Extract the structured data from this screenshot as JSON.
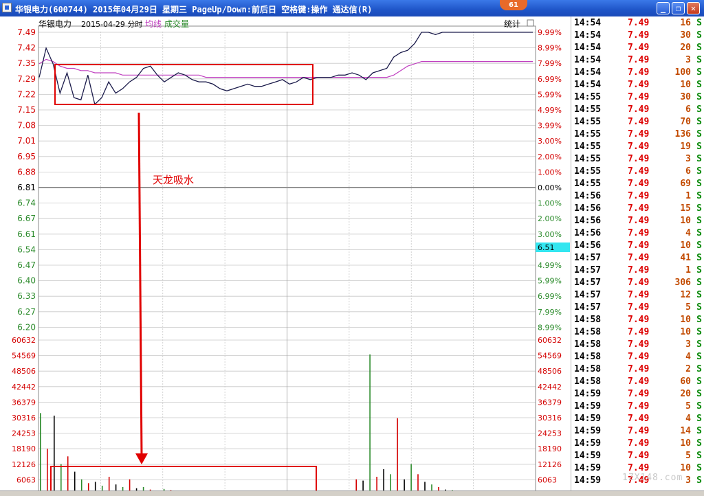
{
  "window": {
    "title": "华银电力(600744) 2015年04月29日 星期三 PageUp/Down:前后日 空格键:操作 通达信(R)",
    "badge": "61",
    "min_glyph": "_",
    "max_glyph": "❐",
    "close_glyph": "✕"
  },
  "chart_header": {
    "stock_name": "华银电力",
    "date_label": "2015-04-29 分时",
    "avg_label": "均线",
    "vol_label": "成交量",
    "stats_button": "统计"
  },
  "annotation": {
    "text": "天龙吸水",
    "color": "#e00000"
  },
  "colors": {
    "up": "#d40000",
    "down": "#2a8a2a",
    "price_line": "#1a1a4a",
    "avg_line": "#c040c0",
    "grid": "#c8c8c8",
    "flag_bg": "#33e6f0"
  },
  "chart_data": {
    "type": "line",
    "price_axis": {
      "ticks": [
        "7.49",
        "7.42",
        "7.35",
        "7.29",
        "7.22",
        "7.15",
        "7.08",
        "7.01",
        "6.95",
        "6.88",
        "6.81",
        "6.74",
        "6.67",
        "6.61",
        "6.54",
        "6.47",
        "6.40",
        "6.33",
        "6.27",
        "6.20"
      ],
      "pct": [
        "9.99%",
        "8.99%",
        "7.99%",
        "6.99%",
        "5.99%",
        "4.99%",
        "3.99%",
        "3.00%",
        "2.00%",
        "1.00%",
        "0.00%",
        "1.00%",
        "2.00%",
        "3.00%",
        "",
        "4.99%",
        "5.99%",
        "6.99%",
        "7.99%",
        "8.99%"
      ],
      "prev_close": 6.81,
      "current_flag": "6.51"
    },
    "volume_axis": {
      "ticks": [
        "60632",
        "54569",
        "48506",
        "42442",
        "36379",
        "30316",
        "24253",
        "18190",
        "12126",
        "6063"
      ]
    },
    "price_series": [
      7.29,
      7.42,
      7.35,
      7.22,
      7.31,
      7.2,
      7.19,
      7.3,
      7.17,
      7.2,
      7.27,
      7.22,
      7.24,
      7.27,
      7.29,
      7.33,
      7.34,
      7.3,
      7.27,
      7.29,
      7.31,
      7.3,
      7.28,
      7.27,
      7.27,
      7.26,
      7.24,
      7.23,
      7.24,
      7.25,
      7.26,
      7.25,
      7.25,
      7.26,
      7.27,
      7.28,
      7.26,
      7.27,
      7.29,
      7.28,
      7.29,
      7.29,
      7.29,
      7.3,
      7.3,
      7.31,
      7.3,
      7.28,
      7.31,
      7.32,
      7.33,
      7.38,
      7.4,
      7.41,
      7.44,
      7.49,
      7.49,
      7.48,
      7.49,
      7.49,
      7.49,
      7.49,
      7.49,
      7.49,
      7.49,
      7.49,
      7.49,
      7.49,
      7.49,
      7.49,
      7.49,
      7.49
    ],
    "avg_series": [
      7.35,
      7.37,
      7.36,
      7.34,
      7.33,
      7.33,
      7.32,
      7.32,
      7.31,
      7.31,
      7.31,
      7.31,
      7.3,
      7.3,
      7.3,
      7.3,
      7.3,
      7.3,
      7.3,
      7.3,
      7.3,
      7.3,
      7.3,
      7.3,
      7.29,
      7.29,
      7.29,
      7.29,
      7.29,
      7.29,
      7.29,
      7.29,
      7.29,
      7.29,
      7.29,
      7.29,
      7.29,
      7.29,
      7.29,
      7.29,
      7.29,
      7.29,
      7.29,
      7.29,
      7.29,
      7.29,
      7.29,
      7.29,
      7.29,
      7.29,
      7.29,
      7.3,
      7.32,
      7.34,
      7.35,
      7.36,
      7.36,
      7.36,
      7.36,
      7.36,
      7.36,
      7.36,
      7.36,
      7.36,
      7.36,
      7.36,
      7.36,
      7.36,
      7.36,
      7.36,
      7.36,
      7.36
    ],
    "volume_series": [
      32000,
      18000,
      31000,
      12000,
      15000,
      9000,
      6000,
      4500,
      5000,
      3500,
      7000,
      4000,
      3000,
      6000,
      2500,
      3000,
      2000,
      1500,
      2200,
      1800,
      1500,
      1200,
      1000,
      1300,
      1100,
      900,
      1000,
      800,
      700,
      900,
      800,
      700,
      600,
      700,
      800,
      600,
      500,
      700,
      600,
      500,
      400,
      500,
      600,
      400,
      500,
      500,
      6000,
      5500,
      55000,
      7000,
      10000,
      8000,
      30000,
      6000,
      12000,
      8000,
      5000,
      4000,
      3000,
      2000,
      1800,
      1500,
      1200,
      1000,
      1200,
      900,
      800,
      700,
      600,
      500,
      600,
      700
    ]
  },
  "ticks": [
    {
      "time": "14:54",
      "price": "7.49",
      "vol": "16",
      "side": "S"
    },
    {
      "time": "14:54",
      "price": "7.49",
      "vol": "30",
      "side": "S"
    },
    {
      "time": "14:54",
      "price": "7.49",
      "vol": "20",
      "side": "S"
    },
    {
      "time": "14:54",
      "price": "7.49",
      "vol": "3",
      "side": "S"
    },
    {
      "time": "14:54",
      "price": "7.49",
      "vol": "100",
      "side": "S"
    },
    {
      "time": "14:54",
      "price": "7.49",
      "vol": "10",
      "side": "S"
    },
    {
      "time": "14:55",
      "price": "7.49",
      "vol": "30",
      "side": "S"
    },
    {
      "time": "14:55",
      "price": "7.49",
      "vol": "6",
      "side": "S"
    },
    {
      "time": "14:55",
      "price": "7.49",
      "vol": "70",
      "side": "S"
    },
    {
      "time": "14:55",
      "price": "7.49",
      "vol": "136",
      "side": "S"
    },
    {
      "time": "14:55",
      "price": "7.49",
      "vol": "19",
      "side": "S"
    },
    {
      "time": "14:55",
      "price": "7.49",
      "vol": "3",
      "side": "S"
    },
    {
      "time": "14:55",
      "price": "7.49",
      "vol": "6",
      "side": "S"
    },
    {
      "time": "14:55",
      "price": "7.49",
      "vol": "69",
      "side": "S"
    },
    {
      "time": "14:56",
      "price": "7.49",
      "vol": "1",
      "side": "S"
    },
    {
      "time": "14:56",
      "price": "7.49",
      "vol": "15",
      "side": "S"
    },
    {
      "time": "14:56",
      "price": "7.49",
      "vol": "10",
      "side": "S"
    },
    {
      "time": "14:56",
      "price": "7.49",
      "vol": "4",
      "side": "S"
    },
    {
      "time": "14:56",
      "price": "7.49",
      "vol": "10",
      "side": "S"
    },
    {
      "time": "14:57",
      "price": "7.49",
      "vol": "41",
      "side": "S"
    },
    {
      "time": "14:57",
      "price": "7.49",
      "vol": "1",
      "side": "S"
    },
    {
      "time": "14:57",
      "price": "7.49",
      "vol": "306",
      "side": "S"
    },
    {
      "time": "14:57",
      "price": "7.49",
      "vol": "12",
      "side": "S"
    },
    {
      "time": "14:57",
      "price": "7.49",
      "vol": "5",
      "side": "S"
    },
    {
      "time": "14:58",
      "price": "7.49",
      "vol": "10",
      "side": "S"
    },
    {
      "time": "14:58",
      "price": "7.49",
      "vol": "10",
      "side": "S"
    },
    {
      "time": "14:58",
      "price": "7.49",
      "vol": "3",
      "side": "S"
    },
    {
      "time": "14:58",
      "price": "7.49",
      "vol": "4",
      "side": "S"
    },
    {
      "time": "14:58",
      "price": "7.49",
      "vol": "2",
      "side": "S"
    },
    {
      "time": "14:58",
      "price": "7.49",
      "vol": "60",
      "side": "S"
    },
    {
      "time": "14:59",
      "price": "7.49",
      "vol": "20",
      "side": "S"
    },
    {
      "time": "14:59",
      "price": "7.49",
      "vol": "5",
      "side": "S"
    },
    {
      "time": "14:59",
      "price": "7.49",
      "vol": "4",
      "side": "S"
    },
    {
      "time": "14:59",
      "price": "7.49",
      "vol": "14",
      "side": "S"
    },
    {
      "time": "14:59",
      "price": "7.49",
      "vol": "10",
      "side": "S"
    },
    {
      "time": "14:59",
      "price": "7.49",
      "vol": "5",
      "side": "S"
    },
    {
      "time": "14:59",
      "price": "7.49",
      "vol": "10",
      "side": "S"
    },
    {
      "time": "14:59",
      "price": "7.49",
      "vol": "3",
      "side": "S"
    }
  ],
  "watermark": "1ZX148.com"
}
